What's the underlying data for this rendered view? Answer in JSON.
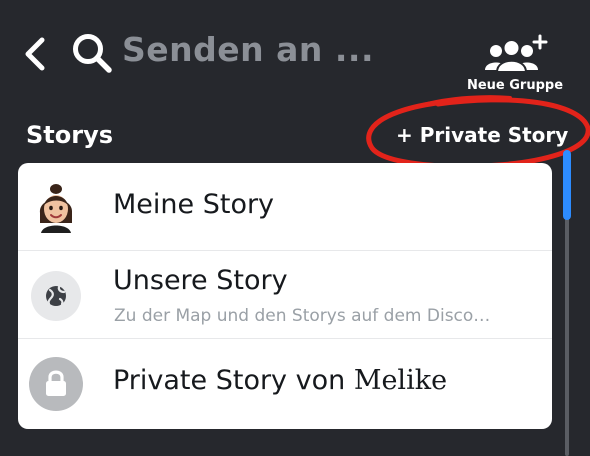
{
  "header": {
    "search_text": "Senden an ...",
    "new_group_label": "Neue Gruppe"
  },
  "section": {
    "title": "Storys",
    "private_story_button": "+ Private Story"
  },
  "stories": [
    {
      "title": "Meine Story",
      "subtitle": "",
      "icon": "bitmoji-avatar-icon"
    },
    {
      "title": "Unsere Story",
      "subtitle": "Zu der Map und den Storys auf dem Disco…",
      "icon": "globe-icon"
    },
    {
      "title": "Private Story von ",
      "title_handwritten": "Melike",
      "subtitle": "",
      "icon": "lock-icon"
    }
  ],
  "colors": {
    "background": "#26282d",
    "card": "#ffffff",
    "annotation": "#e2231a",
    "scrollbar": "#2d8cff"
  }
}
